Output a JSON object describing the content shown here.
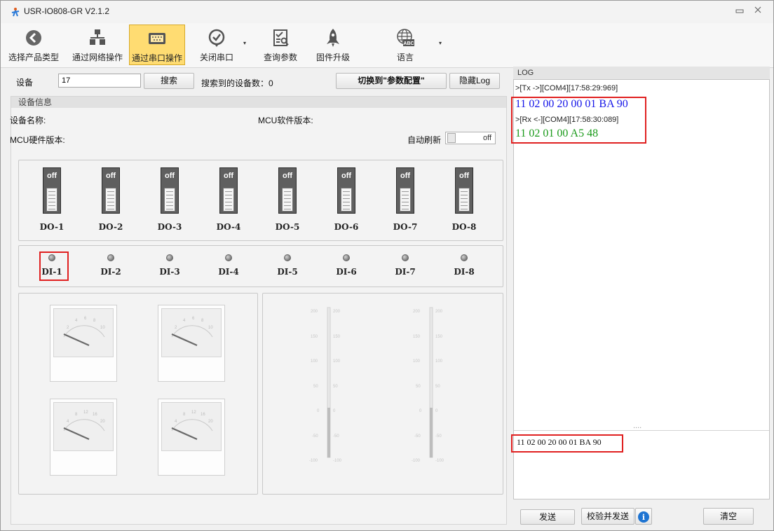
{
  "window": {
    "title": "USR-IO808-GR V2.1.2",
    "minimize_glyph": "▭",
    "close_glyph": "ꕤ"
  },
  "toolbar": {
    "items": [
      {
        "label": "选择产品类型",
        "icon": "back-arrow-icon"
      },
      {
        "label": "通过网络操作",
        "icon": "network-icon"
      },
      {
        "label": "通过串口操作",
        "icon": "serial-port-icon",
        "active": true
      },
      {
        "label": "关闭串口",
        "icon": "check-circle-icon"
      },
      {
        "label": "查询参数",
        "icon": "query-icon"
      },
      {
        "label": "固件升级",
        "icon": "rocket-icon"
      },
      {
        "label": "语言",
        "icon": "globe-abc-icon"
      }
    ],
    "caret": "▾"
  },
  "search": {
    "device_label": "设备",
    "device_value": "17",
    "search_button": "搜索",
    "found_label": "搜索到的设备数：0",
    "switch_button": "切换到\"参数配置\"",
    "hide_log_button": "隐藏Log"
  },
  "device_info": {
    "header": "设备信息",
    "name_label": "设备名称:",
    "mcu_sw_label": "MCU软件版本:",
    "mcu_hw_label": "MCU硬件版本:",
    "auto_refresh_label": "自动刷新",
    "auto_refresh_state": "off"
  },
  "outputs": [
    {
      "label": "DO-1",
      "state": "off"
    },
    {
      "label": "DO-2",
      "state": "off"
    },
    {
      "label": "DO-3",
      "state": "off"
    },
    {
      "label": "DO-4",
      "state": "off"
    },
    {
      "label": "DO-5",
      "state": "off"
    },
    {
      "label": "DO-6",
      "state": "off"
    },
    {
      "label": "DO-7",
      "state": "off"
    },
    {
      "label": "DO-8",
      "state": "off"
    }
  ],
  "inputs": [
    {
      "label": "DI-1"
    },
    {
      "label": "DI-2"
    },
    {
      "label": "DI-3"
    },
    {
      "label": "DI-4"
    },
    {
      "label": "DI-5"
    },
    {
      "label": "DI-6"
    },
    {
      "label": "DI-7"
    },
    {
      "label": "DI-8"
    }
  ],
  "gauges": {
    "top_ticks": [
      "2",
      "4",
      "6",
      "8",
      "10"
    ],
    "bottom_ticks": [
      "4",
      "8",
      "12",
      "16",
      "20"
    ]
  },
  "level_scale": [
    "200",
    "150",
    "100",
    "50",
    "0",
    "-50",
    "-100"
  ],
  "log": {
    "header": "LOG",
    "tx_line": ">[Tx ->][COM4][17:58:29:969]",
    "tx_hex": "11 02 00 20 00 01 BA 90",
    "rx_line": ">[Rx <-][COM4][17:58:30:089]",
    "rx_hex": "11 02 01 00 A5 48",
    "splitter": "....",
    "input_value": "11 02 00 20 00 01 BA 90",
    "send_button": "发送",
    "verify_send_button": "校验并发送",
    "info_glyph": "i",
    "clear_button": "清空",
    "tx_color": "#1515e8",
    "rx_color": "#1a9a1a"
  }
}
